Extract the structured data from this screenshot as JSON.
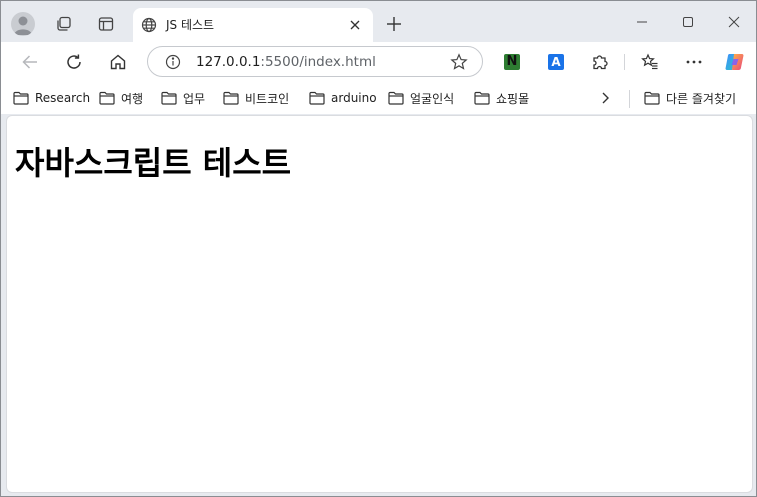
{
  "browser": {
    "tab": {
      "title": "JS 테스트"
    },
    "address_bar": {
      "host": "127.0.0.1",
      "path": ":5500/index.html"
    },
    "extensions": {
      "n_label": "N",
      "a_label": "A"
    },
    "bookmarks": [
      {
        "label": "Research"
      },
      {
        "label": "여행"
      },
      {
        "label": "업무"
      },
      {
        "label": "비트코인"
      },
      {
        "label": "arduino"
      },
      {
        "label": "얼굴인식"
      },
      {
        "label": "쇼핑몰"
      }
    ],
    "other_bookmarks": {
      "label": "다른 즐겨찾기"
    }
  },
  "page": {
    "heading": "자바스크립트 테스트"
  },
  "colors": {
    "accent": "#0b57d0",
    "frame": "#e7eaef",
    "n_ext": "#2e7d32",
    "a_ext": "#1a73e8"
  }
}
